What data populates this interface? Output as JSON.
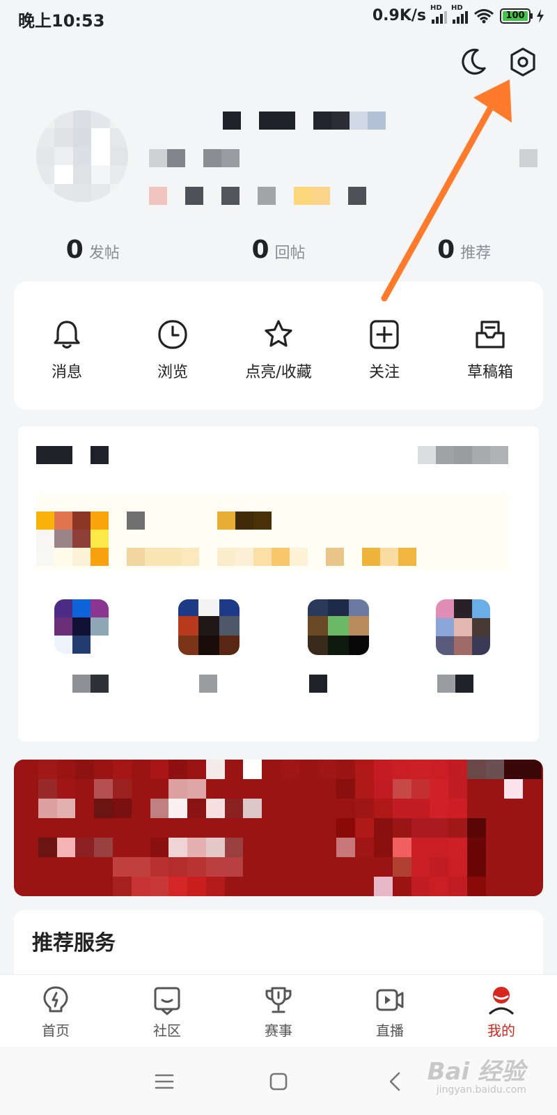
{
  "status_bar": {
    "time": "晚上10:53",
    "net_speed": "0.9K/s",
    "signal_tag": "HD",
    "battery": "100"
  },
  "profile": {
    "stats": [
      {
        "count": "0",
        "label": "发帖"
      },
      {
        "count": "0",
        "label": "回帖"
      },
      {
        "count": "0",
        "label": "推荐"
      }
    ]
  },
  "quick_actions": [
    {
      "label": "消息",
      "icon": "bell-icon"
    },
    {
      "label": "浏览",
      "icon": "clock-icon"
    },
    {
      "label": "点亮/收藏",
      "icon": "star-icon"
    },
    {
      "label": "关注",
      "icon": "plus-square-icon"
    },
    {
      "label": "草稿箱",
      "icon": "draft-box-icon"
    }
  ],
  "recommend": {
    "title": "推荐服务"
  },
  "tabs": [
    {
      "label": "首页",
      "icon": "home-bulb-icon"
    },
    {
      "label": "社区",
      "icon": "community-icon"
    },
    {
      "label": "赛事",
      "icon": "trophy-icon"
    },
    {
      "label": "直播",
      "icon": "live-video-icon"
    },
    {
      "label": "我的",
      "icon": "profile-icon",
      "active": true
    }
  ],
  "watermark": {
    "brand": "Bai 经验",
    "url": "jingyan.baidu.com"
  },
  "colors": {
    "accent": "#d7261e",
    "arrow": "#ff7a2a",
    "page_bg": "#f4f5f7",
    "banner": "#9a1414"
  }
}
